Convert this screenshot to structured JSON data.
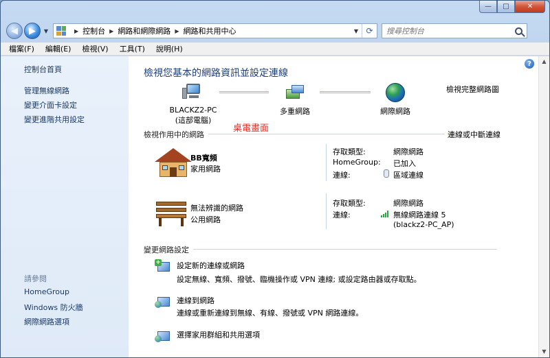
{
  "window": {
    "caption": {
      "minimize": "—",
      "maximize": "□",
      "close": "✕"
    }
  },
  "address_bar": {
    "crumbs": [
      "控制台",
      "網路和網際網路",
      "網路和共用中心"
    ],
    "search_placeholder": "搜尋控制台"
  },
  "menu": [
    "檔案(F)",
    "編輯(E)",
    "檢視(V)",
    "工具(T)",
    "說明(H)"
  ],
  "sidebar": {
    "home": "控制台首頁",
    "links": [
      "管理無線網路",
      "變更介面卡設定",
      "變更進階共用設定"
    ],
    "see_also_heading": "請參閱",
    "see_also": [
      "HomeGroup",
      "Windows 防火牆",
      "網際網路選項"
    ]
  },
  "main": {
    "title": "檢視您基本的網路資訊並設定連線",
    "view_full_map": "檢視完整網路圖",
    "map": {
      "node1_line1": "BLACKZ2-PC",
      "node1_line2": "(這部電腦)",
      "node2": "多重網路",
      "node3": "網際網路"
    },
    "overlay_note": "桌電畫面",
    "active_section": "檢視作用中的網路",
    "connect_disconnect": "連線或中斷連線",
    "networks": [
      {
        "name": "BB寬頻",
        "type": "家用網路",
        "access_label": "存取類型:",
        "access_value": "網際網路",
        "homegroup_label": "HomeGroup:",
        "homegroup_value": "已加入",
        "connection_label": "連線:",
        "connection_value": "區域連線"
      },
      {
        "name": "無法辨識的網路",
        "type": "公用網路",
        "access_label": "存取類型:",
        "access_value": "網際網路",
        "connection_label": "連線:",
        "connection_value_line1": "無線網路連線 5",
        "connection_value_line2": "(blackz2-PC_AP)"
      }
    ],
    "change_section": "變更網路設定",
    "tasks": [
      {
        "title": "設定新的連線或網路",
        "desc": "設定無線、寬頻、撥號、臨機操作或 VPN 連線; 或設定路由器或存取點。"
      },
      {
        "title": "連線到網路",
        "desc": "連線或重新連線到無線、有線、撥號或 VPN 網路連線。"
      },
      {
        "title": "選擇家用群組和共用選項",
        "desc": ""
      }
    ]
  },
  "colors": {
    "link": "#2168c9",
    "title": "#1f3e7a",
    "overlay": "#e0312a"
  }
}
